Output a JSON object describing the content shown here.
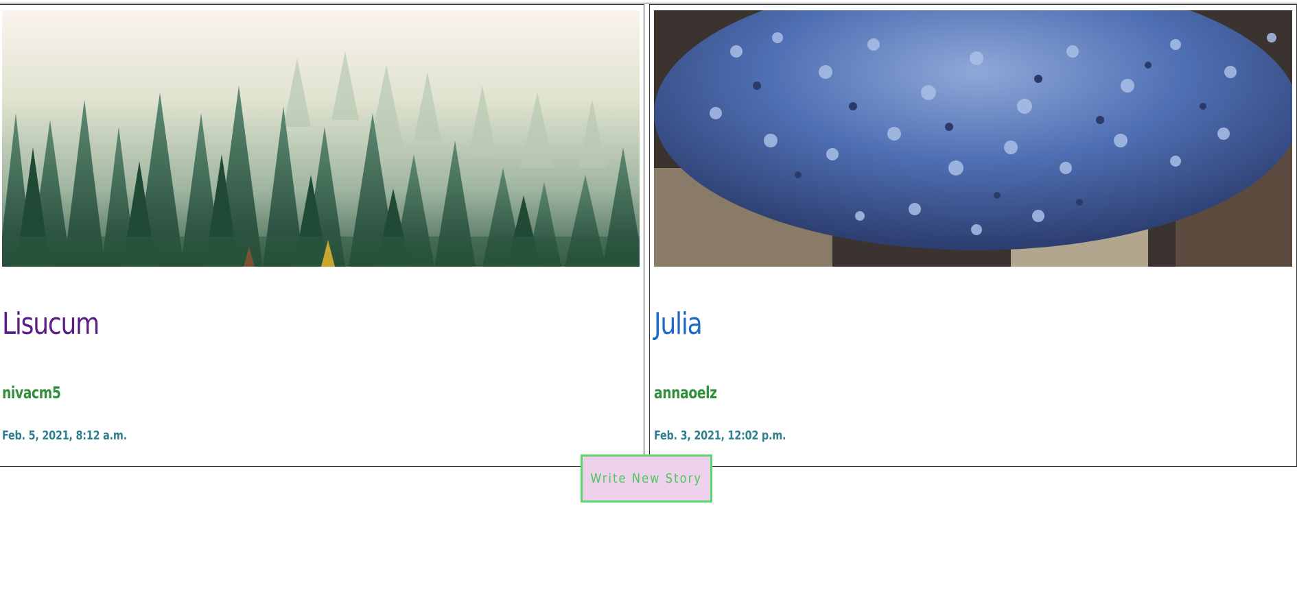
{
  "stories": [
    {
      "title": "Lisucum",
      "author": "nivacm5",
      "date": "Feb. 5, 2021, 8:12 a.m.",
      "image": "foggy-forest-image",
      "title_color": "#5b1e87"
    },
    {
      "title": "Julia",
      "author": "annaoelz",
      "date": "Feb. 3, 2021, 12:02 p.m.",
      "image": "lavender-flowers-image",
      "title_color": "#1f6ac8"
    }
  ],
  "colors": {
    "author": "#2f8f3a",
    "date": "#2f7f8f",
    "button_bg": "#eed1ea",
    "button_border": "#56d86a",
    "button_text": "#4ec45f"
  },
  "actions": {
    "write_label": "Write New Story"
  }
}
